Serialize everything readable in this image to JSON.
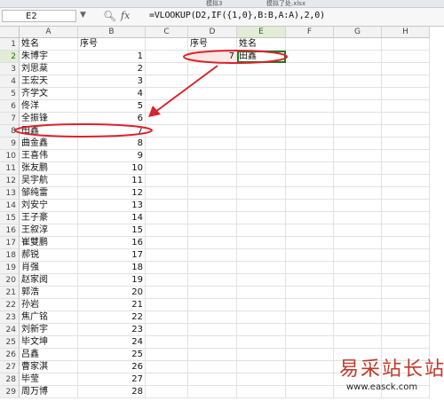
{
  "tabs": [
    "模拟3",
    "模拟了处.xlsx"
  ],
  "formula_bar": {
    "cell_ref": "E2",
    "formula": "=VLOOKUP(D2,IF({1,0},B:B,A:A),2,0)"
  },
  "columns": [
    "A",
    "B",
    "C",
    "D",
    "E",
    "F",
    "G",
    "H"
  ],
  "active_column": "E",
  "active_row": 2,
  "rows": [
    {
      "n": "1",
      "a": "姓名",
      "b": "序号",
      "d": "序号",
      "e": "姓名"
    },
    {
      "n": "2",
      "a": "朱博宇",
      "b": "1",
      "d": "7",
      "e": "田鑫"
    },
    {
      "n": "3",
      "a": "刘思棻",
      "b": "2",
      "d": "",
      "e": ""
    },
    {
      "n": "4",
      "a": "王宏天",
      "b": "3",
      "d": "",
      "e": ""
    },
    {
      "n": "5",
      "a": "齐学文",
      "b": "4",
      "d": "",
      "e": ""
    },
    {
      "n": "6",
      "a": "佟洋",
      "b": "5",
      "d": "",
      "e": ""
    },
    {
      "n": "7",
      "a": "全振锋",
      "b": "6",
      "d": "",
      "e": ""
    },
    {
      "n": "8",
      "a": "田鑫",
      "b": "7",
      "d": "",
      "e": ""
    },
    {
      "n": "9",
      "a": "曲金鑫",
      "b": "8",
      "d": "",
      "e": ""
    },
    {
      "n": "10",
      "a": "王喜伟",
      "b": "9",
      "d": "",
      "e": ""
    },
    {
      "n": "11",
      "a": "张友鹏",
      "b": "10",
      "d": "",
      "e": ""
    },
    {
      "n": "12",
      "a": "吴宇航",
      "b": "11",
      "d": "",
      "e": ""
    },
    {
      "n": "13",
      "a": "邹纯雷",
      "b": "12",
      "d": "",
      "e": ""
    },
    {
      "n": "14",
      "a": "刘安宁",
      "b": "13",
      "d": "",
      "e": ""
    },
    {
      "n": "15",
      "a": "王子豪",
      "b": "14",
      "d": "",
      "e": ""
    },
    {
      "n": "16",
      "a": "王叙淳",
      "b": "15",
      "d": "",
      "e": ""
    },
    {
      "n": "17",
      "a": "崔雙鹏",
      "b": "16",
      "d": "",
      "e": ""
    },
    {
      "n": "18",
      "a": "郝锐",
      "b": "17",
      "d": "",
      "e": ""
    },
    {
      "n": "19",
      "a": "肖强",
      "b": "18",
      "d": "",
      "e": ""
    },
    {
      "n": "20",
      "a": "赵家阅",
      "b": "19",
      "d": "",
      "e": ""
    },
    {
      "n": "21",
      "a": "郭浩",
      "b": "20",
      "d": "",
      "e": ""
    },
    {
      "n": "22",
      "a": "孙岩",
      "b": "21",
      "d": "",
      "e": ""
    },
    {
      "n": "23",
      "a": "焦广铭",
      "b": "22",
      "d": "",
      "e": ""
    },
    {
      "n": "24",
      "a": "刘新宇",
      "b": "23",
      "d": "",
      "e": ""
    },
    {
      "n": "25",
      "a": "毕文坤",
      "b": "24",
      "d": "",
      "e": ""
    },
    {
      "n": "26",
      "a": "吕鑫",
      "b": "25",
      "d": "",
      "e": ""
    },
    {
      "n": "27",
      "a": "曹家淇",
      "b": "26",
      "d": "",
      "e": ""
    },
    {
      "n": "28",
      "a": "毕莹",
      "b": "27",
      "d": "",
      "e": ""
    },
    {
      "n": "29",
      "a": "周万博",
      "b": "28",
      "d": "",
      "e": ""
    }
  ],
  "watermark": {
    "title": "易采站长站",
    "url": "www.easck.com"
  },
  "colors": {
    "annotation": "#d9232d",
    "selection": "#1e7a1e",
    "highlight_fill": "#fde9e4",
    "watermark": "#c0392b"
  }
}
